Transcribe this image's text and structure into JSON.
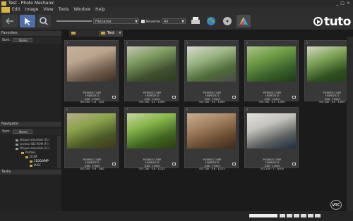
{
  "window": {
    "title": "Test - Photo Mechanic",
    "buttons": [
      "_",
      "□",
      "×"
    ]
  },
  "menu": [
    "Edit",
    "Image",
    "View",
    "Tools",
    "Window",
    "Help"
  ],
  "toolbar": {
    "sort_field": "Filename",
    "reverse_label": "Reverse",
    "filter_value": "All"
  },
  "brand": {
    "text": "tuto"
  },
  "panels": {
    "favorites": {
      "title": "Favorites",
      "sort_label": "Sort:",
      "sort_value": "Name"
    },
    "navigator": {
      "title": "Navigator",
      "sort_label": "Sort:",
      "sort_value": "Name"
    },
    "tasks": {
      "title": "Tasks"
    }
  },
  "tree": [
    "Disque amovible (D:)",
    "Lecteur BD-ROM (F:)",
    "Disque amovible (G:)",
    "Profiles",
    "DCIM",
    "110OLYMP",
    "MISC"
  ],
  "tabs": [
    {
      "label": ""
    },
    {
      "label": "Test"
    }
  ],
  "photos": [
    {
      "num": "1",
      "file": "P0308017.ORF",
      "date": "19/08/2012",
      "exp": "1/40 · 17mm",
      "iso": "ISO 200 · 1.6 · 1/40",
      "colors": [
        "#6e5a4a",
        "#b9a48e",
        "#c9b39a",
        "#3b2e26"
      ]
    },
    {
      "num": "2",
      "file": "P0308017.ORF",
      "date": "19/08/2012",
      "exp": "1/40 · 17mm",
      "iso": "ISO 200 · 4.5 · 1/500",
      "colors": [
        "#3f4f2e",
        "#7e9b5f",
        "#c8c7b8",
        "#2f3a22"
      ]
    },
    {
      "num": "3",
      "file": "P0308017.ORF",
      "date": "19/08/2012",
      "exp": "1/40 · 17mm",
      "iso": "ISO 200 · 4.5 · 1/500",
      "colors": [
        "#4e6a39",
        "#9cb584",
        "#d9dad0",
        "#4a4a4a"
      ]
    },
    {
      "num": "4",
      "file": "P0308017.ORF",
      "date": "19/08/2012",
      "exp": "1/40 · 17mm",
      "iso": "ISO 200 · 4.5 · 1/500",
      "colors": [
        "#385f2a",
        "#6e9b44",
        "#aac48b",
        "#203a16"
      ]
    },
    {
      "num": "5",
      "file": "P0308017.ORF",
      "date": "19/08/2012",
      "exp": "1/40 · 17mm",
      "iso": "ISO 200 · 4.5 · 1/500",
      "colors": [
        "#2f5020",
        "#7ea356",
        "#d4d7c4",
        "#233a18"
      ]
    },
    {
      "num": "6",
      "file": "P0308017.ORF",
      "date": "19/08/2012",
      "exp": "1/40 · 17mm",
      "iso": "ISO 200 · 5.6 · 1/60",
      "colors": [
        "#4b5a26",
        "#8da24d",
        "#b6b08a",
        "#3e3520"
      ]
    },
    {
      "num": "7",
      "file": "P0308017.ORF",
      "date": "19/08/2012",
      "exp": "1/40 · 17mm",
      "iso": "ISO 200 · 5.6 · 1/125",
      "colors": [
        "#3f6420",
        "#87b44a",
        "#c6d6a4",
        "#2c3c14"
      ]
    },
    {
      "num": "8",
      "file": "P0308017.ORF",
      "date": "19/08/2012",
      "exp": "1/40 · 17mm",
      "iso": "ISO 200 · 5.6 · 1/125",
      "colors": [
        "#6a4c32",
        "#a38262",
        "#c8b091",
        "#3a2a1c"
      ]
    },
    {
      "num": "9",
      "file": "P0308017.ORF",
      "date": "19/08/2012",
      "exp": "1/40 · 17mm",
      "iso": "ISO 200 · 7 · 1/400",
      "colors": [
        "#5a5e5e",
        "#c4c2bc",
        "#e2e1da",
        "#1f2d3d"
      ]
    }
  ],
  "status_boxes": 6,
  "watermark": "VTC"
}
